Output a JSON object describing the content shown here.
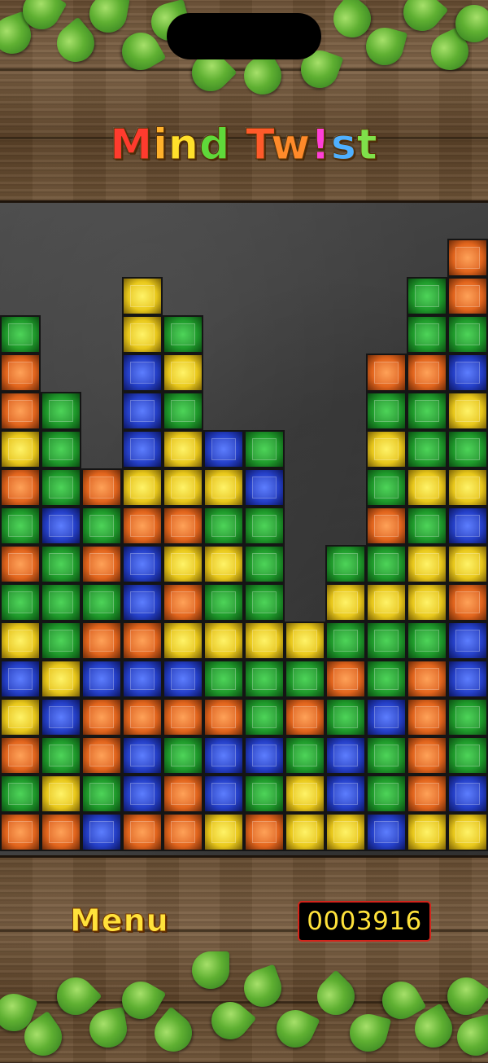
{
  "title": {
    "letters": [
      {
        "ch": "M",
        "color": "#ff3b2e"
      },
      {
        "ch": "i",
        "color": "#ffb12b"
      },
      {
        "ch": "n",
        "color": "#ffe02b"
      },
      {
        "ch": "d",
        "color": "#5fd93a"
      },
      {
        "ch": " ",
        "color": "#ffffff"
      },
      {
        "ch": "T",
        "color": "#ff5a2a"
      },
      {
        "ch": "w",
        "color": "#ff8a2a"
      },
      {
        "ch": "!",
        "color": "#ff3fd8"
      },
      {
        "ch": "s",
        "color": "#4fb0ff"
      },
      {
        "ch": "t",
        "color": "#7fe04a"
      }
    ]
  },
  "menu_label": "Menu",
  "score": "0003916",
  "board": {
    "columns": [
      [
        "O",
        "G",
        "O",
        "Y",
        "B",
        "Y",
        "G",
        "O",
        "G",
        "O",
        "Y",
        "O",
        "O",
        "G"
      ],
      [
        "O",
        "Y",
        "G",
        "B",
        "Y",
        "G",
        "G",
        "G",
        "B",
        "G",
        "G",
        "G"
      ],
      [
        "B",
        "G",
        "O",
        "O",
        "B",
        "O",
        "G",
        "O",
        "G",
        "O"
      ],
      [
        "O",
        "B",
        "B",
        "O",
        "B",
        "O",
        "B",
        "B",
        "O",
        "Y",
        "B",
        "B",
        "B",
        "Y",
        "Y"
      ],
      [
        "O",
        "O",
        "G",
        "O",
        "B",
        "Y",
        "O",
        "Y",
        "O",
        "Y",
        "Y",
        "G",
        "Y",
        "G"
      ],
      [
        "Y",
        "B",
        "B",
        "O",
        "G",
        "Y",
        "G",
        "Y",
        "G",
        "Y",
        "B"
      ],
      [
        "O",
        "G",
        "B",
        "G",
        "G",
        "Y",
        "G",
        "G",
        "G",
        "B",
        "G"
      ],
      [
        "Y",
        "Y",
        "G",
        "O",
        "G",
        "Y"
      ],
      [
        "Y",
        "B",
        "B",
        "G",
        "O",
        "G",
        "Y",
        "G"
      ],
      [
        "B",
        "G",
        "G",
        "B",
        "G",
        "G",
        "Y",
        "G",
        "O",
        "G",
        "Y",
        "G",
        "O"
      ],
      [
        "Y",
        "O",
        "O",
        "O",
        "O",
        "G",
        "Y",
        "Y",
        "G",
        "Y",
        "G",
        "G",
        "O",
        "G",
        "G"
      ],
      [
        "Y",
        "B",
        "G",
        "G",
        "B",
        "B",
        "O",
        "Y",
        "B",
        "Y",
        "G",
        "Y",
        "B",
        "G",
        "O",
        "O"
      ]
    ]
  },
  "colors": {
    "green": "#1f9a2b",
    "orange": "#e2651d",
    "yellow": "#e9c81b",
    "blue": "#2540c8",
    "score_text": "#ffe23b",
    "score_border": "#d4241b",
    "menu_text": "#ffe23b"
  }
}
